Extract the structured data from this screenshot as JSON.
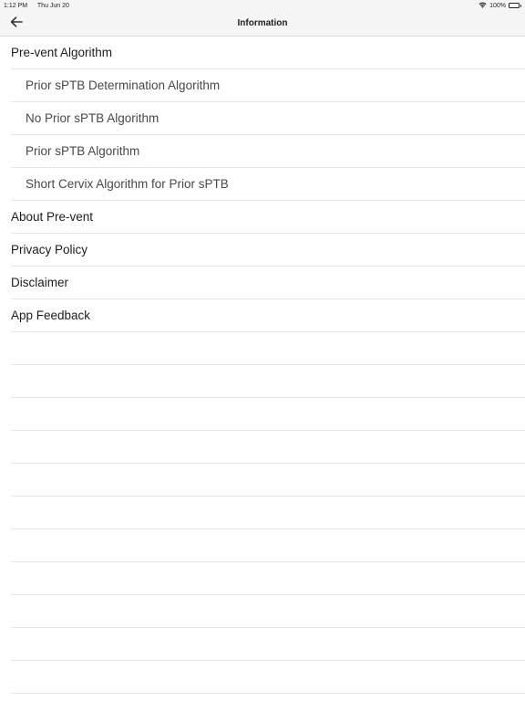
{
  "status_bar": {
    "time": "1:12 PM",
    "date": "Thu Jun 20",
    "battery": "100%",
    "battery_level": 1.0
  },
  "nav": {
    "title": "Information",
    "back_icon": "arrow-left-icon"
  },
  "menu": {
    "items": [
      {
        "label": "Pre-vent Algorithm",
        "level": 0
      },
      {
        "label": "Prior sPTB Determination Algorithm",
        "level": 1
      },
      {
        "label": "No Prior sPTB Algorithm",
        "level": 1
      },
      {
        "label": "Prior sPTB Algorithm",
        "level": 1
      },
      {
        "label": "Short Cervix Algorithm for Prior sPTB",
        "level": 1
      },
      {
        "label": "About Pre-vent",
        "level": 0
      },
      {
        "label": "Privacy Policy",
        "level": 0
      },
      {
        "label": "Disclaimer",
        "level": 0
      },
      {
        "label": "App Feedback",
        "level": 0
      }
    ]
  },
  "colors": {
    "bar_background": "#f5f5f5",
    "separator": "#e6e6e6",
    "text_primary": "#1c1c1e",
    "text_secondary": "#48484a"
  }
}
